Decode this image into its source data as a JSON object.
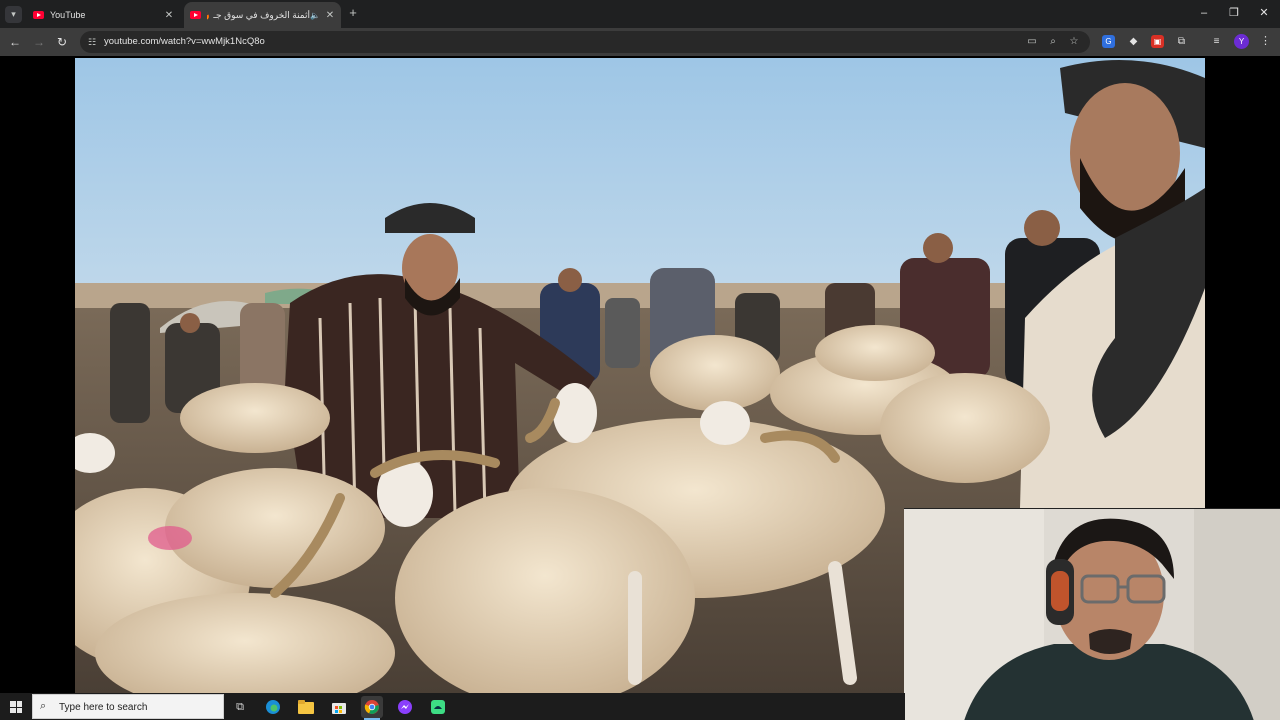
{
  "browser": {
    "tabs": [
      {
        "title": "YouTube",
        "active": false
      },
      {
        "title": "أثمنة الخروف في سوق جـ 🔥",
        "active": true,
        "audio": true
      }
    ],
    "url": "youtube.com/watch?v=wwMjk1NcQ8o",
    "profile_initial": "Y"
  },
  "taskbar": {
    "search_placeholder": "Type here to search"
  },
  "colors": {
    "tab_bg": "#1f2021",
    "toolbar_bg": "#3c3c3c",
    "omnibox_bg": "#282828",
    "youtube_red": "#ff0033",
    "taskbar_bg": "#1c1c1c"
  }
}
